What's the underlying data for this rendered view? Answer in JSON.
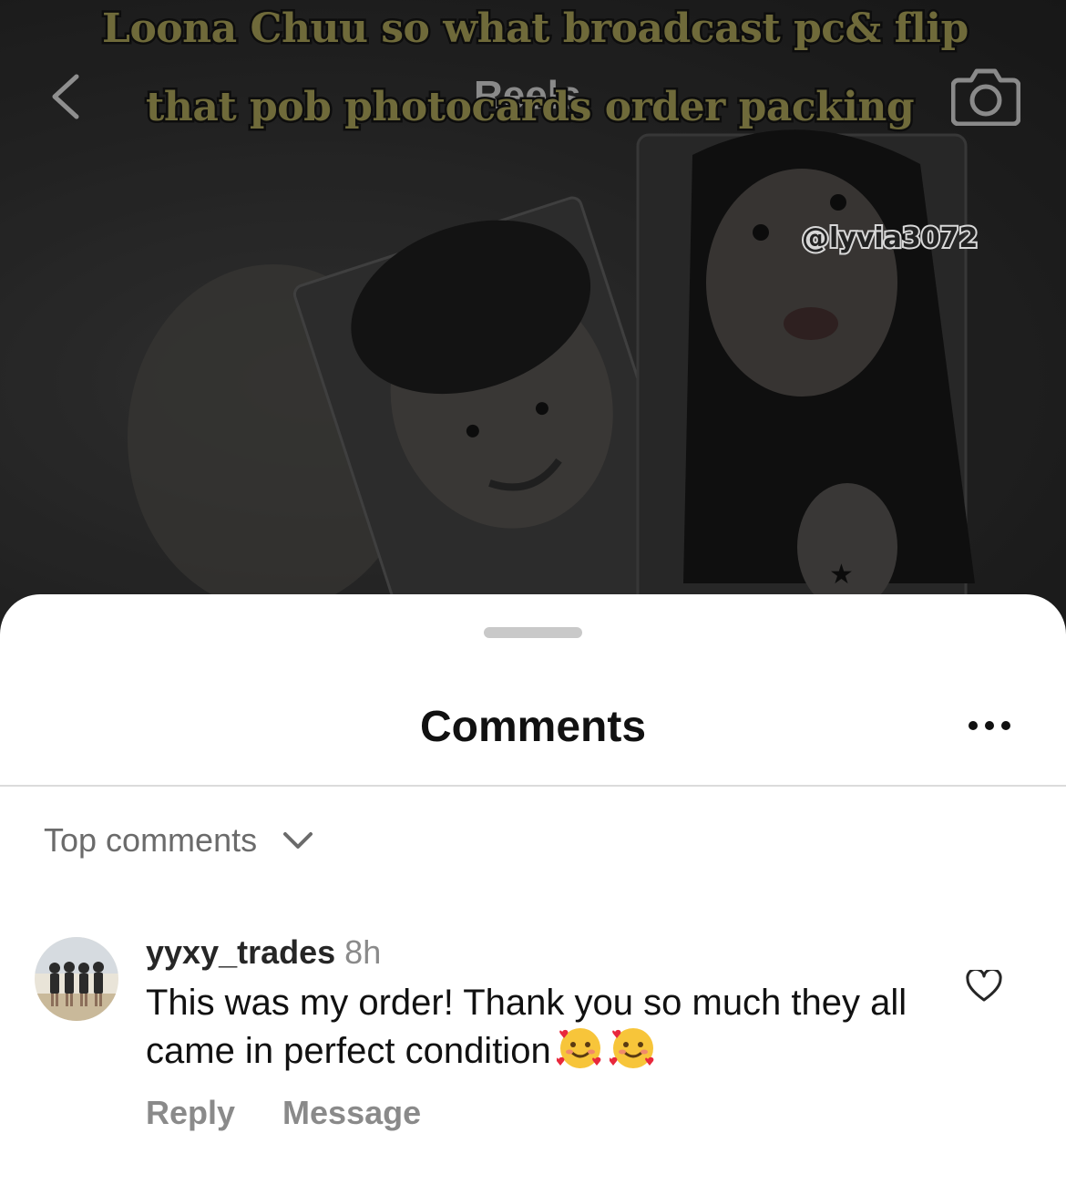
{
  "reel": {
    "caption_line1": "Loona Chuu so what broadcast pc& flip",
    "caption_line2": "that pob photocards order packing",
    "header_title": "Reels",
    "watermark": "@lyvia3072",
    "icons": {
      "back": "chevron-left-icon",
      "camera": "camera-icon"
    }
  },
  "comments_sheet": {
    "title": "Comments",
    "more_icon": "more-horizontal-icon",
    "sort_label": "Top comments",
    "sort_icon": "chevron-down-icon",
    "comments": [
      {
        "username": "yyxy_trades",
        "time": "8h",
        "text": "This was my order! Thank you so much they all came in perfect condition",
        "emojis": [
          "smiling-face-with-hearts",
          "smiling-face-with-hearts"
        ],
        "actions": {
          "reply": "Reply",
          "message": "Message"
        },
        "like_icon": "heart-outline-icon"
      }
    ]
  },
  "colors": {
    "caption_fill": "#6f6a3a",
    "sheet_background": "#ffffff",
    "muted_text": "#8a8a8a",
    "primary_text": "#111111",
    "divider": "#dbdbdb"
  }
}
